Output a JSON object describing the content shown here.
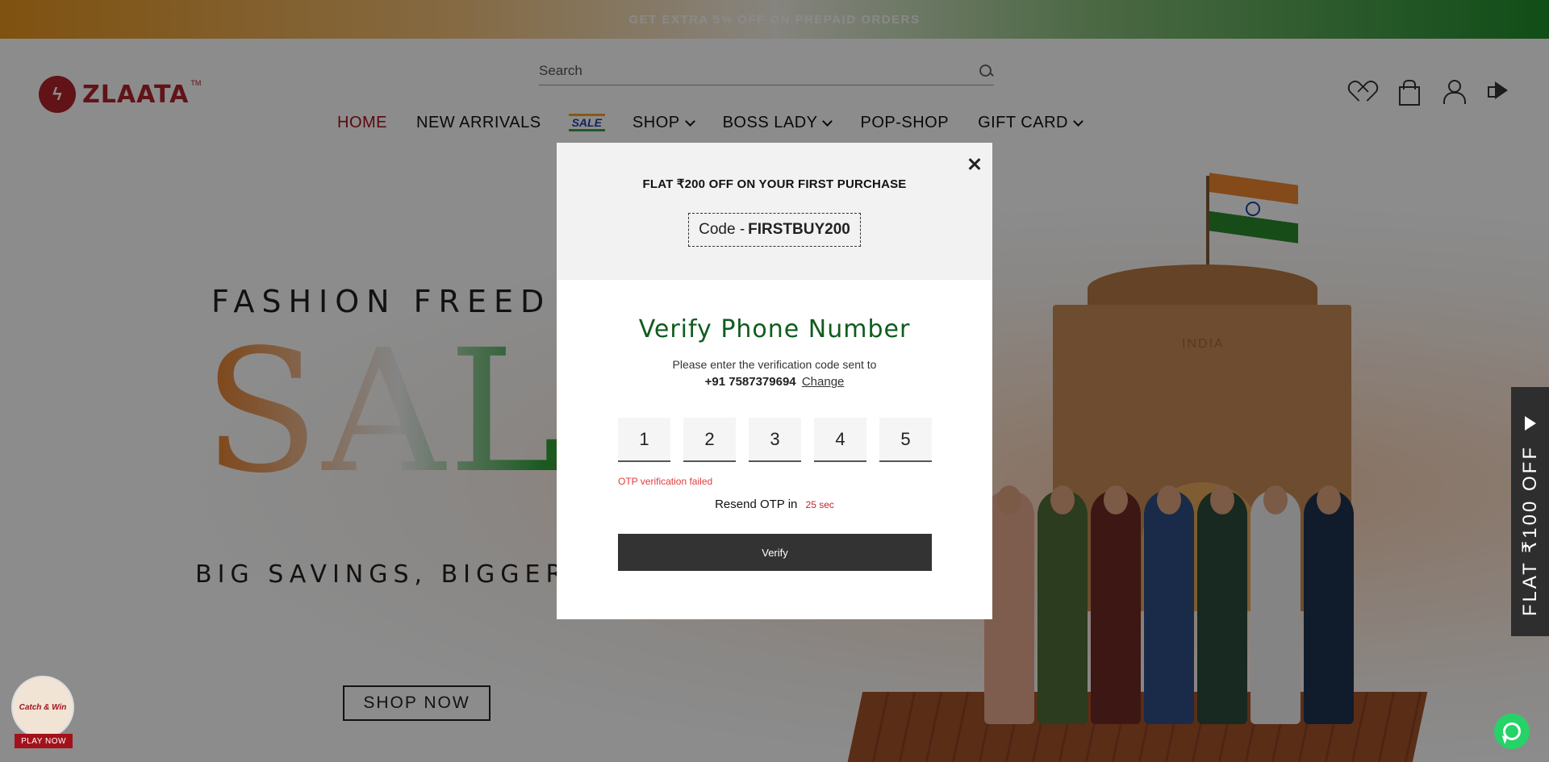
{
  "topbar": {
    "text": "GET EXTRA 5% OFF ON PREPAID ORDERS"
  },
  "header": {
    "logo_text": "ZLAATA",
    "logo_tm": "TM",
    "search": {
      "placeholder": "Search"
    },
    "nav": [
      {
        "label": "HOME",
        "active": true
      },
      {
        "label": "NEW ARRIVALS"
      },
      {
        "label": "SALE"
      },
      {
        "label": "SHOP"
      },
      {
        "label": "BOSS LADY"
      },
      {
        "label": "POP-SHOP"
      },
      {
        "label": "GIFT CARD"
      }
    ]
  },
  "hero": {
    "line1": "FASHION FREED",
    "big": "SALE",
    "line2": "BIG SAVINGS, BIGGER S",
    "cta": "SHOP NOW",
    "gate_label": "INDIA"
  },
  "side_tab": {
    "text": "FLAT ₹100 OFF"
  },
  "play_widget": {
    "label": "Catch & Win",
    "button": "PLAY NOW"
  },
  "modal": {
    "promo_title": "FLAT ₹200 OFF ON YOUR FIRST PURCHASE",
    "code_prefix": "Code -",
    "code": "FIRSTBUY200",
    "title": "Verify Phone Number",
    "description": "Please enter the verification code sent to",
    "phone": "+91 7587379694",
    "change_label": "Change",
    "otp": [
      "1",
      "2",
      "3",
      "4",
      "5"
    ],
    "error": "OTP verification failed",
    "resend_label": "Resend OTP in",
    "resend_timer": "25 sec",
    "verify_label": "Verify"
  },
  "colors": {
    "brand": "#b1242a",
    "nav_active": "#a3121b",
    "verify_title": "#0f5c1e",
    "error": "#e23b3b",
    "button": "#333333"
  }
}
